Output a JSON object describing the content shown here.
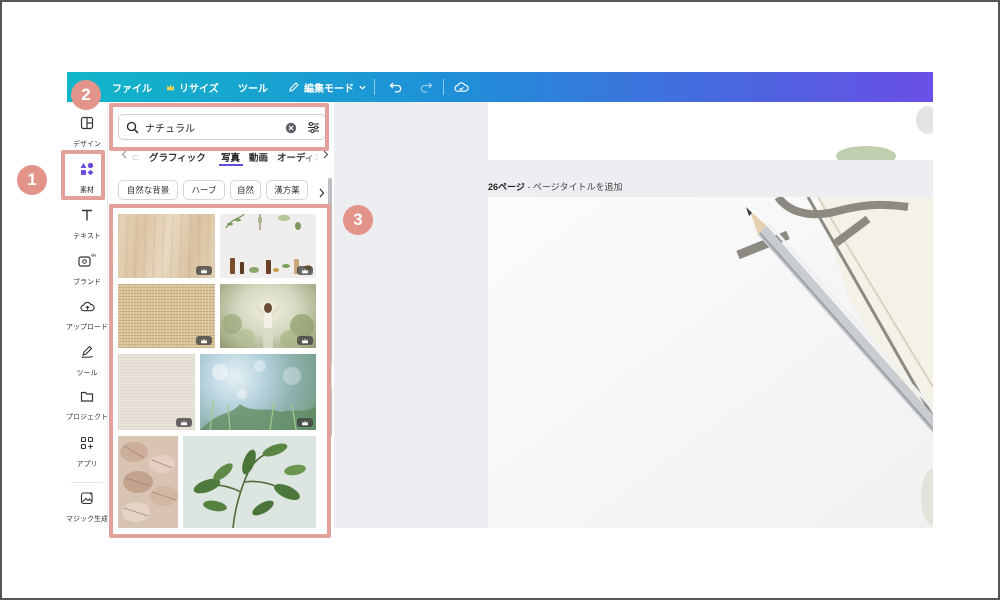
{
  "toolbar": {
    "file_label": "ファイル",
    "resize_label": "リサイズ",
    "tools_label": "ツール",
    "edit_mode_label": "編集モード"
  },
  "rail": {
    "items": [
      {
        "label": "デザイン",
        "icon": "layout-icon"
      },
      {
        "label": "素材",
        "icon": "elements-icon"
      },
      {
        "label": "テキスト",
        "icon": "text-icon"
      },
      {
        "label": "ブランド",
        "icon": "brand-icon"
      },
      {
        "label": "アップロード",
        "icon": "cloud-upload-icon"
      },
      {
        "label": "ツール",
        "icon": "pen-tool-icon"
      },
      {
        "label": "プロジェクト",
        "icon": "folder-icon"
      },
      {
        "label": "アプリ",
        "icon": "apps-icon"
      },
      {
        "label": "マジック生成",
        "icon": "magic-image-icon"
      }
    ]
  },
  "panel": {
    "search_value": "ナチュラル",
    "tabs": [
      "グラフィック",
      "写真",
      "動画",
      "オーディオ"
    ],
    "active_tab": "写真",
    "chips": [
      "自然な背景",
      "ハーブ",
      "自然",
      "漢方薬"
    ]
  },
  "canvas": {
    "page_label_number": "26ページ",
    "page_label_title": " - ページタイトルを追加"
  },
  "annotations": {
    "badge_1": "1",
    "badge_2": "2",
    "badge_3": "3",
    "color": "#e2a29b"
  },
  "colors": {
    "toolbar_start": "#10b6c8",
    "toolbar_end": "#6a4fe6",
    "accent": "#6b4bdc"
  }
}
